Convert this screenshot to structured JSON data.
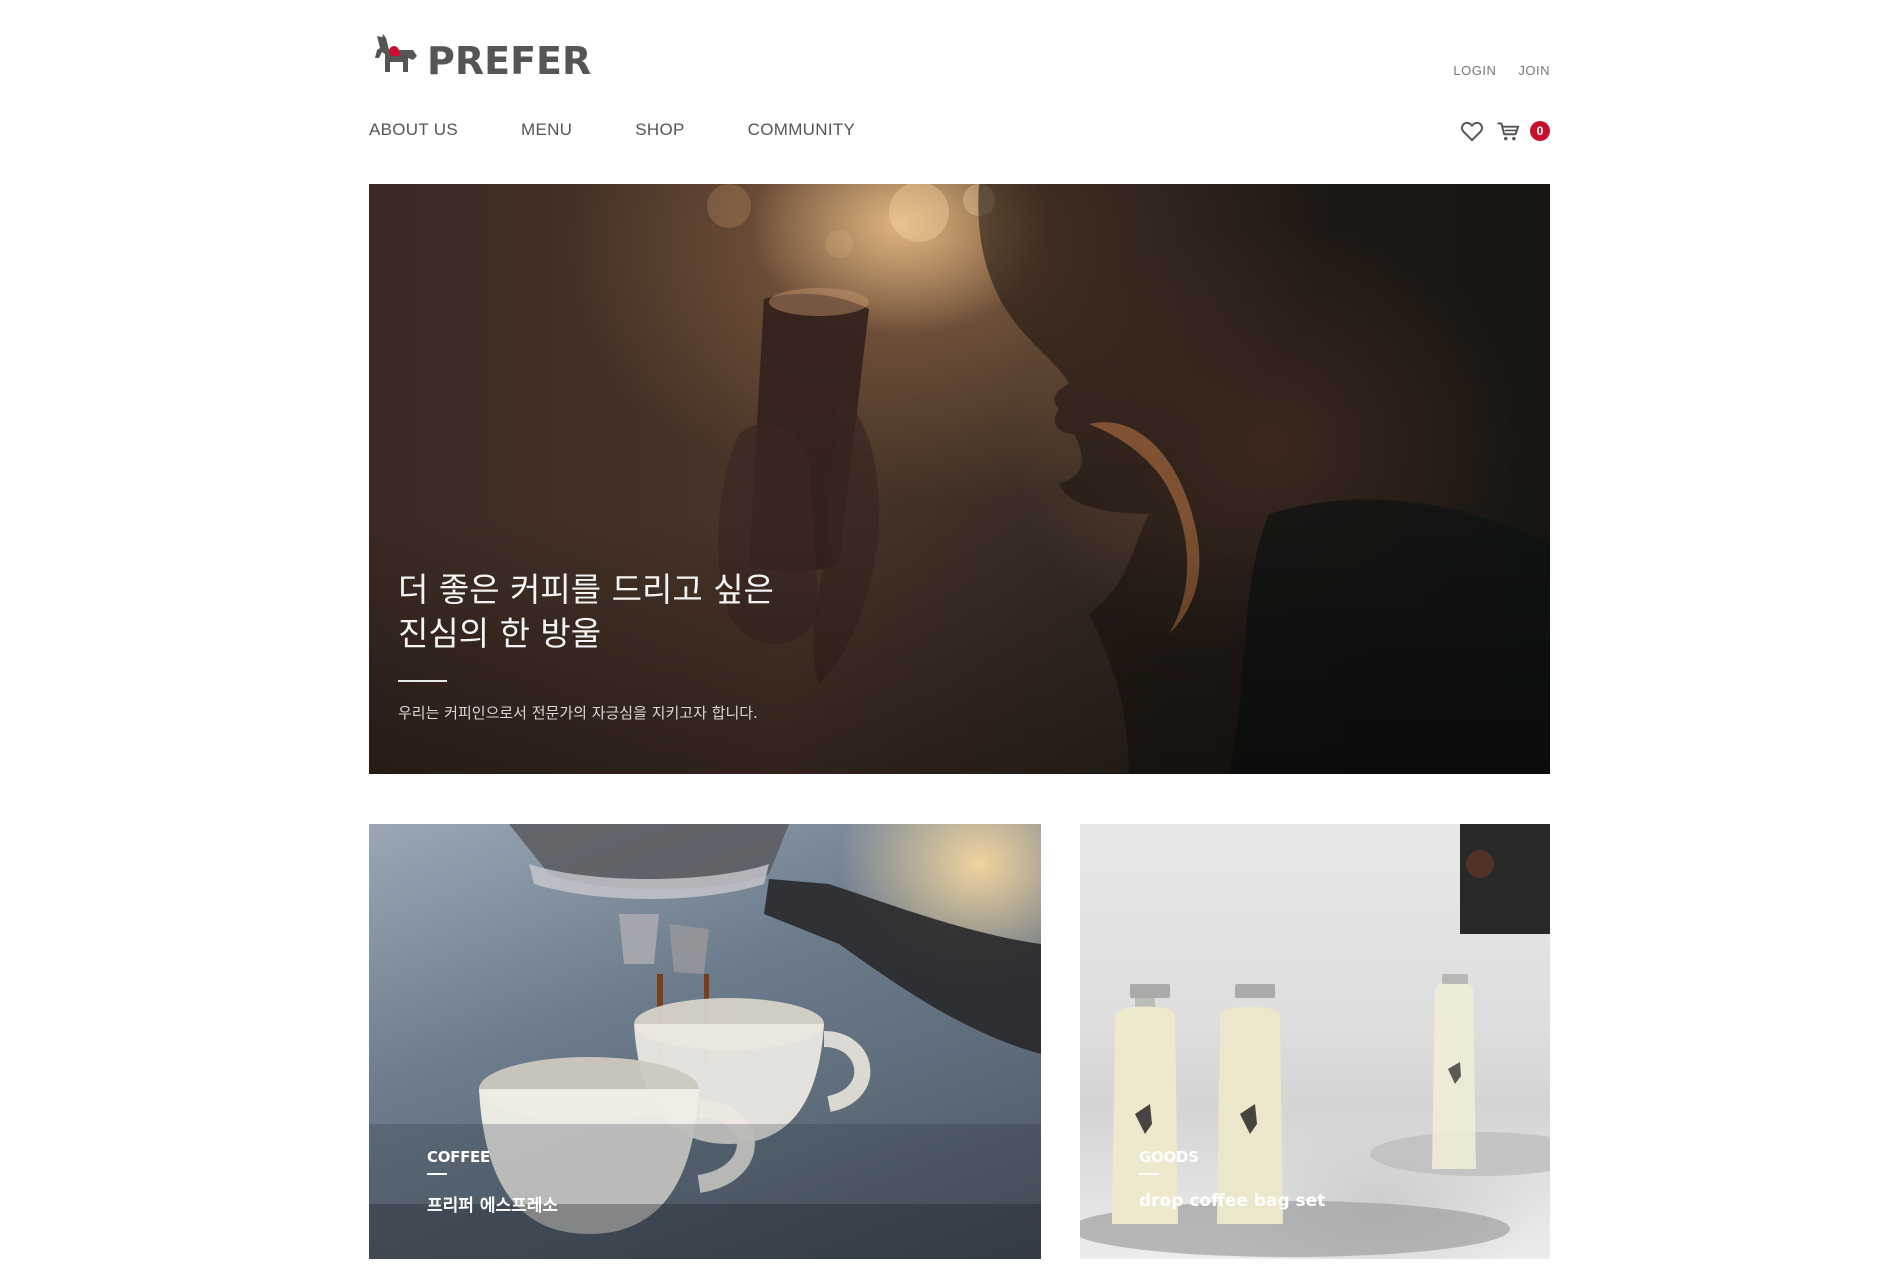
{
  "brand": {
    "name": "PREFER",
    "logo_icon": "donkey-icon"
  },
  "util_nav": {
    "login_label": "LOGIN",
    "join_label": "JOIN"
  },
  "main_nav": {
    "items": [
      {
        "label": "ABOUT US"
      },
      {
        "label": "MENU"
      },
      {
        "label": "SHOP"
      },
      {
        "label": "COMMUNITY"
      }
    ]
  },
  "shop_icons": {
    "wishlist_icon": "heart-icon",
    "cart_icon": "cart-icon",
    "cart_count": "0",
    "badge_color": "#c8102e"
  },
  "hero": {
    "title": "더 좋은 커피를 드리고 싶은\n진심의 한 방울",
    "subtitle": "우리는 커피인으로서 전문가의 자긍심을 지키고자 합니다."
  },
  "cards": [
    {
      "category": "COFFEE",
      "name": "프리퍼 에스프레소"
    },
    {
      "category": "GOODS",
      "name": "drop coffee bag set"
    }
  ]
}
